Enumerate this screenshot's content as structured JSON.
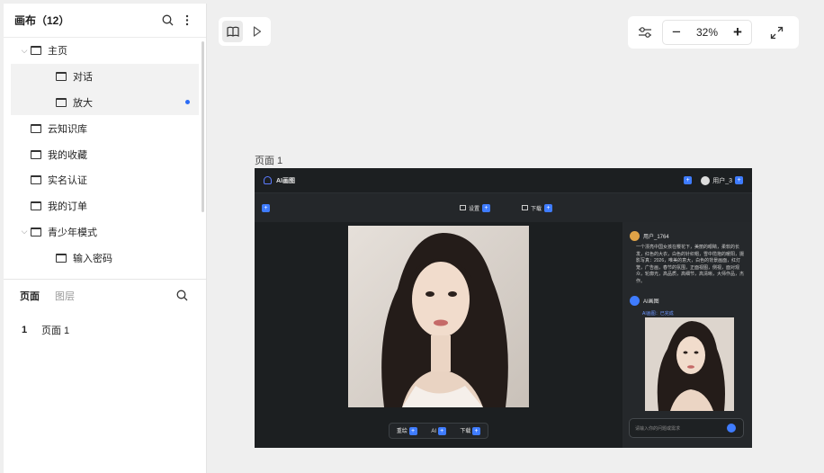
{
  "left_panel": {
    "title": "画布（12）",
    "tree": [
      {
        "label": "主页",
        "chevron": "v",
        "indent": 0,
        "selected": false,
        "dot": false
      },
      {
        "label": "对话",
        "chevron": "",
        "indent": 1,
        "selected": true,
        "dot": false
      },
      {
        "label": "放大",
        "chevron": "",
        "indent": 1,
        "selected": true,
        "dot": true
      },
      {
        "label": "云知识库",
        "chevron": "",
        "indent": 0,
        "selected": false,
        "dot": false
      },
      {
        "label": "我的收藏",
        "chevron": "",
        "indent": 0,
        "selected": false,
        "dot": false
      },
      {
        "label": "实名认证",
        "chevron": "",
        "indent": 0,
        "selected": false,
        "dot": false
      },
      {
        "label": "我的订单",
        "chevron": "",
        "indent": 0,
        "selected": false,
        "dot": false
      },
      {
        "label": "青少年模式",
        "chevron": "v",
        "indent": 0,
        "selected": false,
        "dot": false
      },
      {
        "label": "输入密码",
        "chevron": "",
        "indent": 1,
        "selected": false,
        "dot": false
      }
    ],
    "tabs": {
      "pages": "页面",
      "layers": "图层"
    },
    "pages": [
      {
        "num": "1",
        "label": "页面 1"
      }
    ]
  },
  "toolbar": {
    "zoom": "32%"
  },
  "canvas": {
    "frame_label": "页面 1",
    "preview": {
      "brand": "AI画图",
      "user_name": "用户_3",
      "tool_btn_1": "设置",
      "tool_btn_2": "下载",
      "chat_user": "用户_1764",
      "chat_text": "一个漂亮中国女孩在樱花下，美丽的眼睛，柔软的长发，红色的大衣，白色的针织帽，雪中揽抱的暖阳，摄影写真：2026，唯美的意大，白色的背景画面，红灯笼，广告画，春节的氛围，正面视图，侧视，面对观众，轮廓光，高品质，高细节，高清晰，大师作品，杰作。",
      "ai_name": "AI画图",
      "ai_status": "AI画图：已完成",
      "input_placeholder": "请输入你的问题或需求",
      "bar_btns": [
        "重绘",
        "AI",
        "下载"
      ]
    }
  },
  "colors": {
    "accent": "#2b6cf6",
    "preview_bg": "#1c1f21"
  }
}
